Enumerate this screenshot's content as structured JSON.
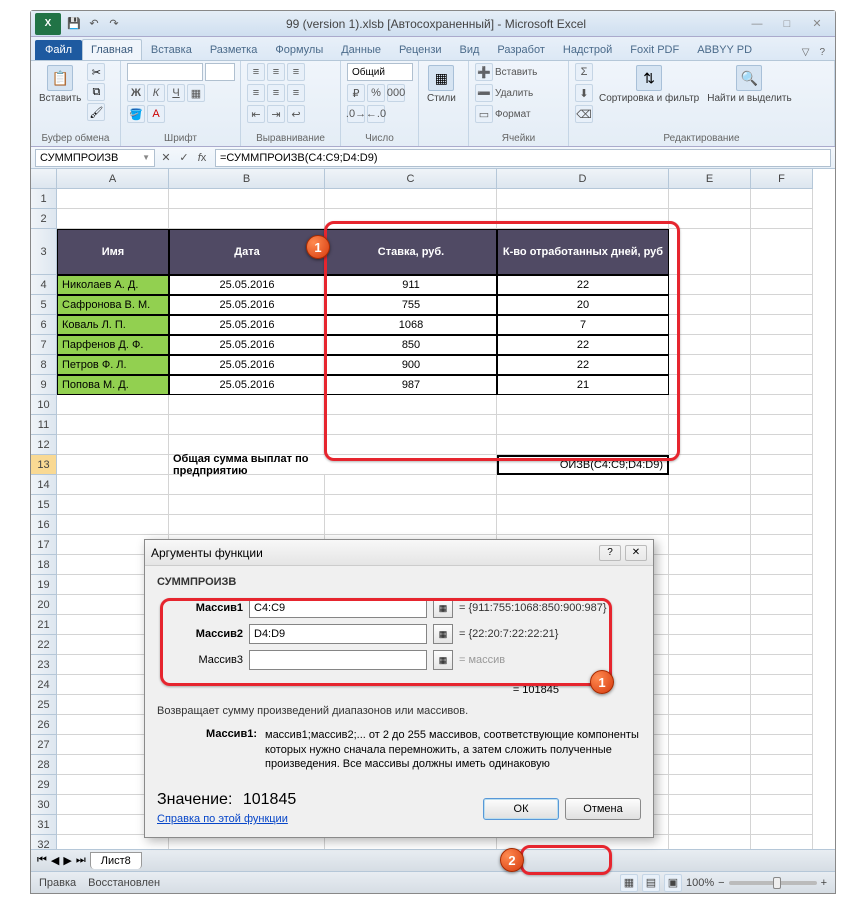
{
  "title_bar": {
    "title": "99 (version 1).xlsb [Автосохраненный] - Microsoft Excel",
    "excel_abbr": "X"
  },
  "ribbon": {
    "file": "Файл",
    "tabs": [
      "Главная",
      "Вставка",
      "Разметка",
      "Формулы",
      "Данные",
      "Рецензи",
      "Вид",
      "Разработ",
      "Надстрой",
      "Foxit PDF",
      "ABBYY PD"
    ],
    "groups": {
      "clipboard": "Буфер обмена",
      "font": "Шрифт",
      "alignment": "Выравнивание",
      "number": "Число",
      "styles": "Стили",
      "cells": "Ячейки",
      "editing": "Редактирование",
      "paste": "Вставить",
      "numfmt": "Общий",
      "insert_btn": "Вставить",
      "delete_btn": "Удалить",
      "format_btn": "Формат",
      "sort": "Сортировка и фильтр",
      "find": "Найти и выделить"
    }
  },
  "formula_bar": {
    "name_box": "СУММПРОИЗВ",
    "formula": "=СУММПРОИЗВ(C4:C9;D4:D9)"
  },
  "columns": {
    "A": "A",
    "B": "B",
    "C": "C",
    "D": "D",
    "E": "E",
    "F": "F"
  },
  "table": {
    "headers": {
      "name": "Имя",
      "date": "Дата",
      "rate": "Ставка, руб.",
      "days": "К-во отработанных дней, руб"
    },
    "rows": [
      {
        "name": "Николаев А. Д.",
        "date": "25.05.2016",
        "rate": "911",
        "days": "22"
      },
      {
        "name": "Сафронова В. М.",
        "date": "25.05.2016",
        "rate": "755",
        "days": "20"
      },
      {
        "name": "Коваль Л. П.",
        "date": "25.05.2016",
        "rate": "1068",
        "days": "7"
      },
      {
        "name": "Парфенов Д. Ф.",
        "date": "25.05.2016",
        "rate": "850",
        "days": "22"
      },
      {
        "name": "Петров Ф. Л.",
        "date": "25.05.2016",
        "rate": "900",
        "days": "22"
      },
      {
        "name": "Попова М. Д.",
        "date": "25.05.2016",
        "rate": "987",
        "days": "21"
      }
    ],
    "total_label": "Общая сумма выплат по предприятию",
    "total_cell": "ОИЗВ(C4:C9;D4:D9)"
  },
  "dialog": {
    "title": "Аргументы функции",
    "fn": "СУММПРОИЗВ",
    "args": [
      {
        "label": "Массив1",
        "value": "C4:C9",
        "result": "= {911:755:1068:850:900:987}"
      },
      {
        "label": "Массив2",
        "value": "D4:D9",
        "result": "= {22:20:7:22:22:21}"
      },
      {
        "label": "Массив3",
        "value": "",
        "result": "= массив"
      }
    ],
    "result_line": "= 101845",
    "desc1": "Возвращает сумму произведений диапазонов или массивов.",
    "desc_arg_label": "Массив1:",
    "desc_arg_text": "массив1;массив2;... от 2 до 255 массивов, соответствующие компоненты которых нужно сначала перемножить, а затем сложить полученные произведения. Все массивы должны иметь одинаковую",
    "value_label": "Значение:",
    "value": "101845",
    "link": "Справка по этой функции",
    "ok": "ОК",
    "cancel": "Отмена"
  },
  "sheet_tabs": {
    "tab": "Лист8"
  },
  "status": {
    "mode": "Правка",
    "autosave": "Восстановлен",
    "zoom": "100%"
  },
  "markers": {
    "m1": "1",
    "m2": "2"
  }
}
